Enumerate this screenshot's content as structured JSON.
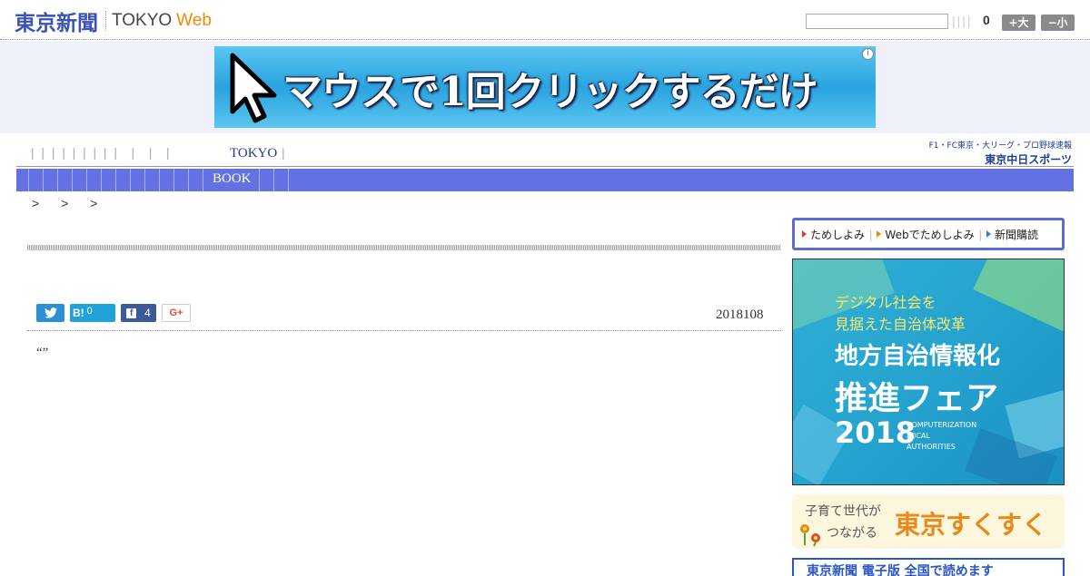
{
  "header": {
    "logo_jp": "東京新聞",
    "logo_en": "TOKYO",
    "logo_web": "Web",
    "search_placeholder": "",
    "bars": "||||",
    "count": "0",
    "font_large": "+大",
    "font_small": "−小"
  },
  "banner": {
    "text": "マウスで1回クリックするだけ",
    "info": "i"
  },
  "nav": {
    "seps": "|  |  |  |  |  |  |  |  |    |    |    |",
    "tokyo": "TOKYO",
    "sep_end": "|",
    "book": "BOOK"
  },
  "chunichi": {
    "top": "F1・FC東京・大リーグ・プロ野球速報",
    "logo": "東京中日スポーツ"
  },
  "breadcrumb": ">  >  >",
  "share": {
    "twitter_icon": "twitter-icon",
    "hatena_label": "B!",
    "hatena_count": "0",
    "facebook_count": "4",
    "gplus_label": "G+"
  },
  "article": {
    "date": "2018108",
    "quote": "“”"
  },
  "sidebar": {
    "links": [
      {
        "label": "ためしよみ",
        "color": "#e03a2b"
      },
      {
        "label": "Webでためしよみ",
        "color": "#f08a00"
      },
      {
        "label": "新聞購読",
        "color": "#3a7be0"
      }
    ],
    "fair": {
      "line1": "デジタル社会を",
      "line2": "見据えた自治体改革",
      "line3": "地方自治情報化",
      "line4": "推進フェア",
      "line5": "2018",
      "sub1": "COMPUTERIZATION",
      "sub2": "LOCAL",
      "sub3": "AUTHORITIES"
    },
    "sukusuku": {
      "line1": "子育て世代が",
      "line2": "つながる",
      "brand": "東京すくすく"
    },
    "bottom": "東京新聞 電子版 全国で読めます"
  },
  "colors": {
    "brand_blue": "#3a52b8",
    "nav_blue": "#6371e2",
    "web_orange": "#f08a00"
  }
}
